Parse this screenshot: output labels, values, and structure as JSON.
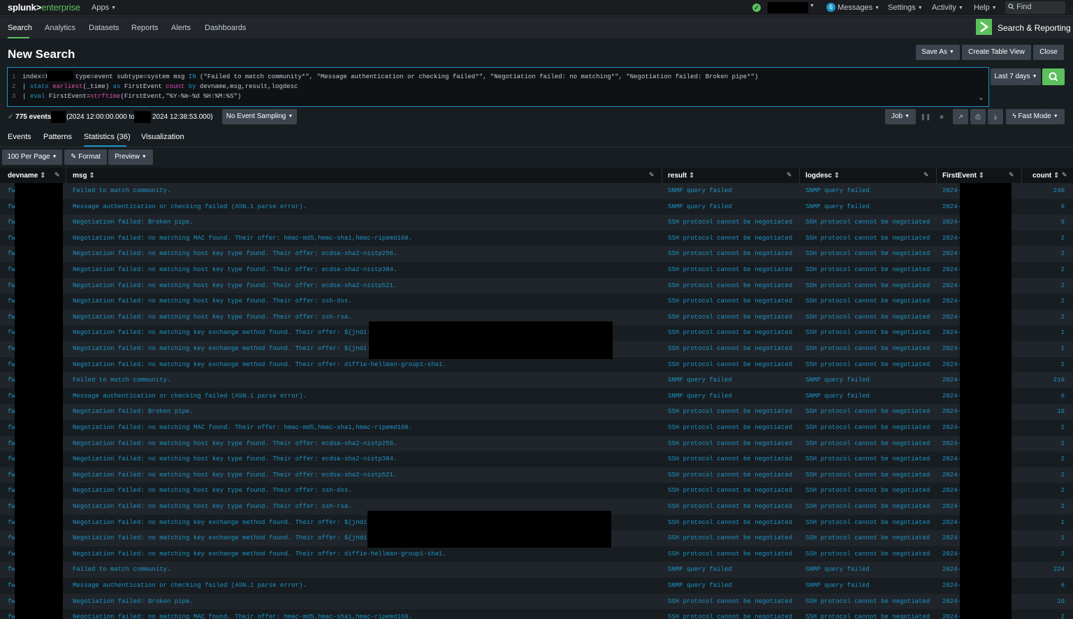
{
  "topbar": {
    "logo_main": "splunk>",
    "logo_sub": "enterprise",
    "apps_label": "Apps",
    "messages_count": "6",
    "messages_label": "Messages",
    "settings_label": "Settings",
    "activity_label": "Activity",
    "help_label": "Help",
    "find_label": "Find"
  },
  "appbar": {
    "tabs": [
      "Search",
      "Analytics",
      "Datasets",
      "Reports",
      "Alerts",
      "Dashboards"
    ],
    "app_name": "Search & Reporting"
  },
  "page": {
    "title": "New Search",
    "save_as": "Save As",
    "create_table_view": "Create Table View",
    "close": "Close"
  },
  "search": {
    "line1_a": "index=f",
    "line1_b": "type=event subtype=system msg ",
    "line1_in": "IN",
    "line1_c": " (\"Failed to match community*\", \"Message authentication or checking failed*\", \"Negotiation failed: no matching*\", \"Negotiation failed: Broken pipe*\")",
    "line2_pipe": "| ",
    "line2_stats": "stats",
    "line2_earliest": "earliest",
    "line2_a": "(_time) ",
    "line2_as": "as",
    "line2_b": " FirstEvent ",
    "line2_count": "count",
    "line2_by": "by",
    "line2_c": " devname,msg,result,logdesc",
    "line3_pipe": "| ",
    "line3_eval": "eval",
    "line3_a": " FirstEvent=",
    "line3_strf": "strftime",
    "line3_b": "(FirstEvent,\"%Y-%m-%d %H:%M:%S\")",
    "time_range": "Last 7 days"
  },
  "status": {
    "events": "775 events",
    "range_a": "(2024 12:00:00.000 to",
    "range_b": "2024 12:38:53.000)",
    "sampling": "No Event Sampling",
    "job": "Job",
    "mode": "Fast Mode"
  },
  "result_tabs": [
    "Events",
    "Patterns",
    "Statistics (36)",
    "Visualization"
  ],
  "controls": {
    "per_page": "100 Per Page",
    "format": "Format",
    "preview": "Preview"
  },
  "columns": [
    "devname",
    "msg",
    "result",
    "logdesc",
    "FirstEvent",
    "count"
  ],
  "rows": [
    {
      "dev": "fw",
      "msg": "Failed to match community.",
      "result": "SNMP query failed",
      "logdesc": "SNMP query failed",
      "first": "2024-",
      "count": "240"
    },
    {
      "dev": "fw",
      "msg": "Message authentication or checking failed (ASN.1 parse error).",
      "result": "SNMP query failed",
      "logdesc": "SNMP query failed",
      "first": "2024-",
      "count": "6"
    },
    {
      "dev": "fw",
      "msg": "Negotiation failed: Broken pipe.",
      "result": "SSH protocol cannot be negotiated",
      "logdesc": "SSH protocol cannot be negotiated",
      "first": "2024-",
      "count": "9"
    },
    {
      "dev": "fw",
      "msg": "Negotiation failed: no matching MAC found. Their offer: hmac-md5,hmac-sha1,hmac-ripemd160.",
      "result": "SSH protocol cannot be negotiated",
      "logdesc": "SSH protocol cannot be negotiated",
      "first": "2024-",
      "count": "2"
    },
    {
      "dev": "fw",
      "msg": "Negotiation failed: no matching host key type found. Their offer: ecdsa-sha2-nistp256.",
      "result": "SSH protocol cannot be negotiated",
      "logdesc": "SSH protocol cannot be negotiated",
      "first": "2024-",
      "count": "2"
    },
    {
      "dev": "fw",
      "msg": "Negotiation failed: no matching host key type found. Their offer: ecdsa-sha2-nistp384.",
      "result": "SSH protocol cannot be negotiated",
      "logdesc": "SSH protocol cannot be negotiated",
      "first": "2024-",
      "count": "2"
    },
    {
      "dev": "fw",
      "msg": "Negotiation failed: no matching host key type found. Their offer: ecdsa-sha2-nistp521.",
      "result": "SSH protocol cannot be negotiated",
      "logdesc": "SSH protocol cannot be negotiated",
      "first": "2024-",
      "count": "2"
    },
    {
      "dev": "fw",
      "msg": "Negotiation failed: no matching host key type found. Their offer: ssh-dss.",
      "result": "SSH protocol cannot be negotiated",
      "logdesc": "SSH protocol cannot be negotiated",
      "first": "2024-",
      "count": "2"
    },
    {
      "dev": "fw",
      "msg": "Negotiation failed: no matching host key type found. Their offer: ssh-rsa.",
      "result": "SSH protocol cannot be negotiated",
      "logdesc": "SSH protocol cannot be negotiated",
      "first": "2024-",
      "count": "2"
    },
    {
      "dev": "fw",
      "msg": "Negotiation failed: no matching key exchange method found. Their offer: ${jndi:ldap://",
      "result": "SSH protocol cannot be negotiated",
      "logdesc": "SSH protocol cannot be negotiated",
      "first": "2024-",
      "count": "1"
    },
    {
      "dev": "fw",
      "msg": "Negotiation failed: no matching key exchange method found. Their offer: ${jndi:ldap://",
      "result": "SSH protocol cannot be negotiated",
      "logdesc": "SSH protocol cannot be negotiated",
      "first": "2024-",
      "count": "1"
    },
    {
      "dev": "fw",
      "msg": "Negotiation failed: no matching key exchange method found. Their offer: diffie-hellman-group1-sha1.",
      "result": "SSH protocol cannot be negotiated",
      "logdesc": "SSH protocol cannot be negotiated",
      "first": "2024-",
      "count": "2"
    },
    {
      "dev": "fw",
      "msg": "Failed to match community.",
      "result": "SNMP query failed",
      "logdesc": "SNMP query failed",
      "first": "2024-",
      "count": "216"
    },
    {
      "dev": "fw",
      "msg": "Message authentication or checking failed (ASN.1 parse error).",
      "result": "SNMP query failed",
      "logdesc": "SNMP query failed",
      "first": "2024-",
      "count": "6"
    },
    {
      "dev": "fw",
      "msg": "Negotiation failed: Broken pipe.",
      "result": "SSH protocol cannot be negotiated",
      "logdesc": "SSH protocol cannot be negotiated",
      "first": "2024-",
      "count": "10"
    },
    {
      "dev": "fw",
      "msg": "Negotiation failed: no matching MAC found. Their offer: hmac-md5,hmac-sha1,hmac-ripemd160.",
      "result": "SSH protocol cannot be negotiated",
      "logdesc": "SSH protocol cannot be negotiated",
      "first": "2024-",
      "count": "2"
    },
    {
      "dev": "fw",
      "msg": "Negotiation failed: no matching host key type found. Their offer: ecdsa-sha2-nistp256.",
      "result": "SSH protocol cannot be negotiated",
      "logdesc": "SSH protocol cannot be negotiated",
      "first": "2024-",
      "count": "2"
    },
    {
      "dev": "fw",
      "msg": "Negotiation failed: no matching host key type found. Their offer: ecdsa-sha2-nistp384.",
      "result": "SSH protocol cannot be negotiated",
      "logdesc": "SSH protocol cannot be negotiated",
      "first": "2024-",
      "count": "2"
    },
    {
      "dev": "fw",
      "msg": "Negotiation failed: no matching host key type found. Their offer: ecdsa-sha2-nistp521.",
      "result": "SSH protocol cannot be negotiated",
      "logdesc": "SSH protocol cannot be negotiated",
      "first": "2024-",
      "count": "2"
    },
    {
      "dev": "fw",
      "msg": "Negotiation failed: no matching host key type found. Their offer: ssh-dss.",
      "result": "SSH protocol cannot be negotiated",
      "logdesc": "SSH protocol cannot be negotiated",
      "first": "2024-",
      "count": "2"
    },
    {
      "dev": "fw",
      "msg": "Negotiation failed: no matching host key type found. Their offer: ssh-rsa.",
      "result": "SSH protocol cannot be negotiated",
      "logdesc": "SSH protocol cannot be negotiated",
      "first": "2024-",
      "count": "2"
    },
    {
      "dev": "fw",
      "msg": "Negotiation failed: no matching key exchange method found. Their offer: ${jndi:ldap://",
      "result": "SSH protocol cannot be negotiated",
      "logdesc": "SSH protocol cannot be negotiated",
      "first": "2024-",
      "count": "1"
    },
    {
      "dev": "fw",
      "msg": "Negotiation failed: no matching key exchange method found. Their offer: ${jndi:ldap://",
      "result": "SSH protocol cannot be negotiated",
      "logdesc": "SSH protocol cannot be negotiated",
      "first": "2024-",
      "count": "1"
    },
    {
      "dev": "fw",
      "msg": "Negotiation failed: no matching key exchange method found. Their offer: diffie-hellman-group1-sha1.",
      "result": "SSH protocol cannot be negotiated",
      "logdesc": "SSH protocol cannot be negotiated",
      "first": "2024-",
      "count": "2"
    },
    {
      "dev": "fw",
      "msg": "Failed to match community.",
      "result": "SNMP query failed",
      "logdesc": "SNMP query failed",
      "first": "2024-",
      "count": "224"
    },
    {
      "dev": "fw",
      "msg": "Message authentication or checking failed (ASN.1 parse error).",
      "result": "SNMP query failed",
      "logdesc": "SNMP query failed",
      "first": "2024-",
      "count": "6"
    },
    {
      "dev": "fw",
      "msg": "Negotiation failed: Broken pipe.",
      "result": "SSH protocol cannot be negotiated",
      "logdesc": "SSH protocol cannot be negotiated",
      "first": "2024-",
      "count": "10"
    },
    {
      "dev": "fw",
      "msg": "Negotiation failed: no matching MAC found. Their offer: hmac-md5,hmac-sha1,hmac-ripemd160.",
      "result": "SSH protocol cannot be negotiated",
      "logdesc": "SSH protocol cannot be negotiated",
      "first": "2024-",
      "count": "2"
    }
  ],
  "colors": {
    "accent_green": "#5cc05c",
    "link_blue": "#1e93c6",
    "background": "#171d21"
  }
}
